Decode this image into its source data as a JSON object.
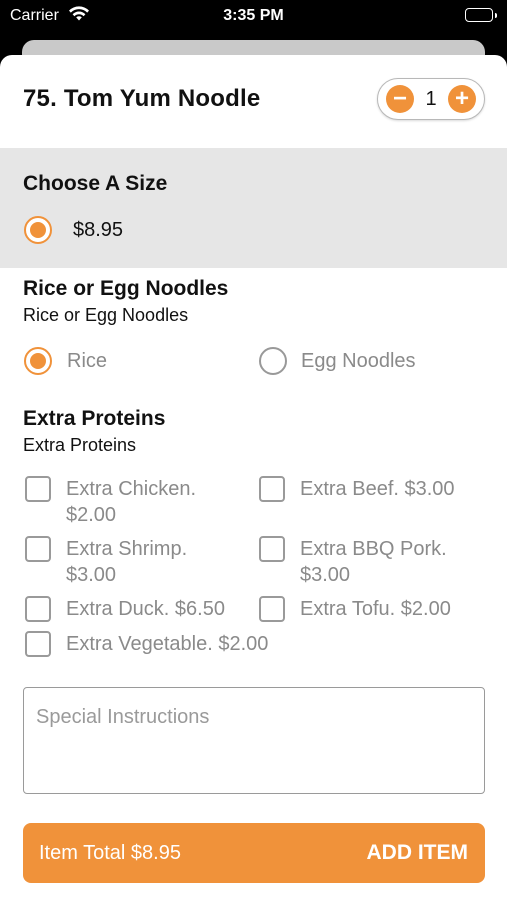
{
  "status_bar": {
    "carrier": "Carrier",
    "time": "3:35 PM"
  },
  "item": {
    "title": "75.  Tom Yum Noodle",
    "quantity": "1",
    "minus_symbol": "−",
    "plus_symbol": "+"
  },
  "size": {
    "title": "Choose A Size",
    "options": [
      {
        "label": "$8.95",
        "selected": true
      }
    ]
  },
  "noodles": {
    "title": "Rice or Egg Noodles",
    "subtitle": "Rice or Egg Noodles",
    "options": [
      {
        "label": "Rice",
        "selected": true
      },
      {
        "label": "Egg Noodles",
        "selected": false
      }
    ]
  },
  "proteins": {
    "title": "Extra Proteins",
    "subtitle": "Extra Proteins",
    "options": [
      {
        "label": "Extra Chicken. $2.00",
        "line1": "Extra Chicken.",
        "line2": "$2.00",
        "checked": false
      },
      {
        "label": "Extra Beef. $3.00",
        "line1": "Extra Beef. $3.00",
        "line2": "",
        "checked": false
      },
      {
        "label": "Extra Shrimp. $3.00",
        "line1": "Extra Shrimp.",
        "line2": "$3.00",
        "checked": false
      },
      {
        "label": "Extra BBQ Pork. $3.00",
        "line1": "Extra BBQ Pork.",
        "line2": "$3.00",
        "checked": false
      },
      {
        "label": "Extra Duck. $6.50",
        "line1": "Extra Duck. $6.50",
        "line2": "",
        "checked": false
      },
      {
        "label": "Extra Tofu. $2.00",
        "line1": "Extra Tofu. $2.00",
        "line2": "",
        "checked": false
      },
      {
        "label": "Extra Vegetable. $2.00",
        "line1": "Extra Vegetable. $2.00",
        "line2": "",
        "checked": false
      }
    ]
  },
  "special_instructions": {
    "placeholder": "Special Instructions",
    "value": ""
  },
  "add_bar": {
    "total": "Item Total $8.95",
    "button_label": "ADD ITEM"
  },
  "colors": {
    "accent": "#f0923a",
    "section_bg": "#e6e6e6",
    "muted_text": "#8a8a8a"
  },
  "icons": {
    "wifi": "wifi-icon",
    "battery": "battery-icon"
  }
}
